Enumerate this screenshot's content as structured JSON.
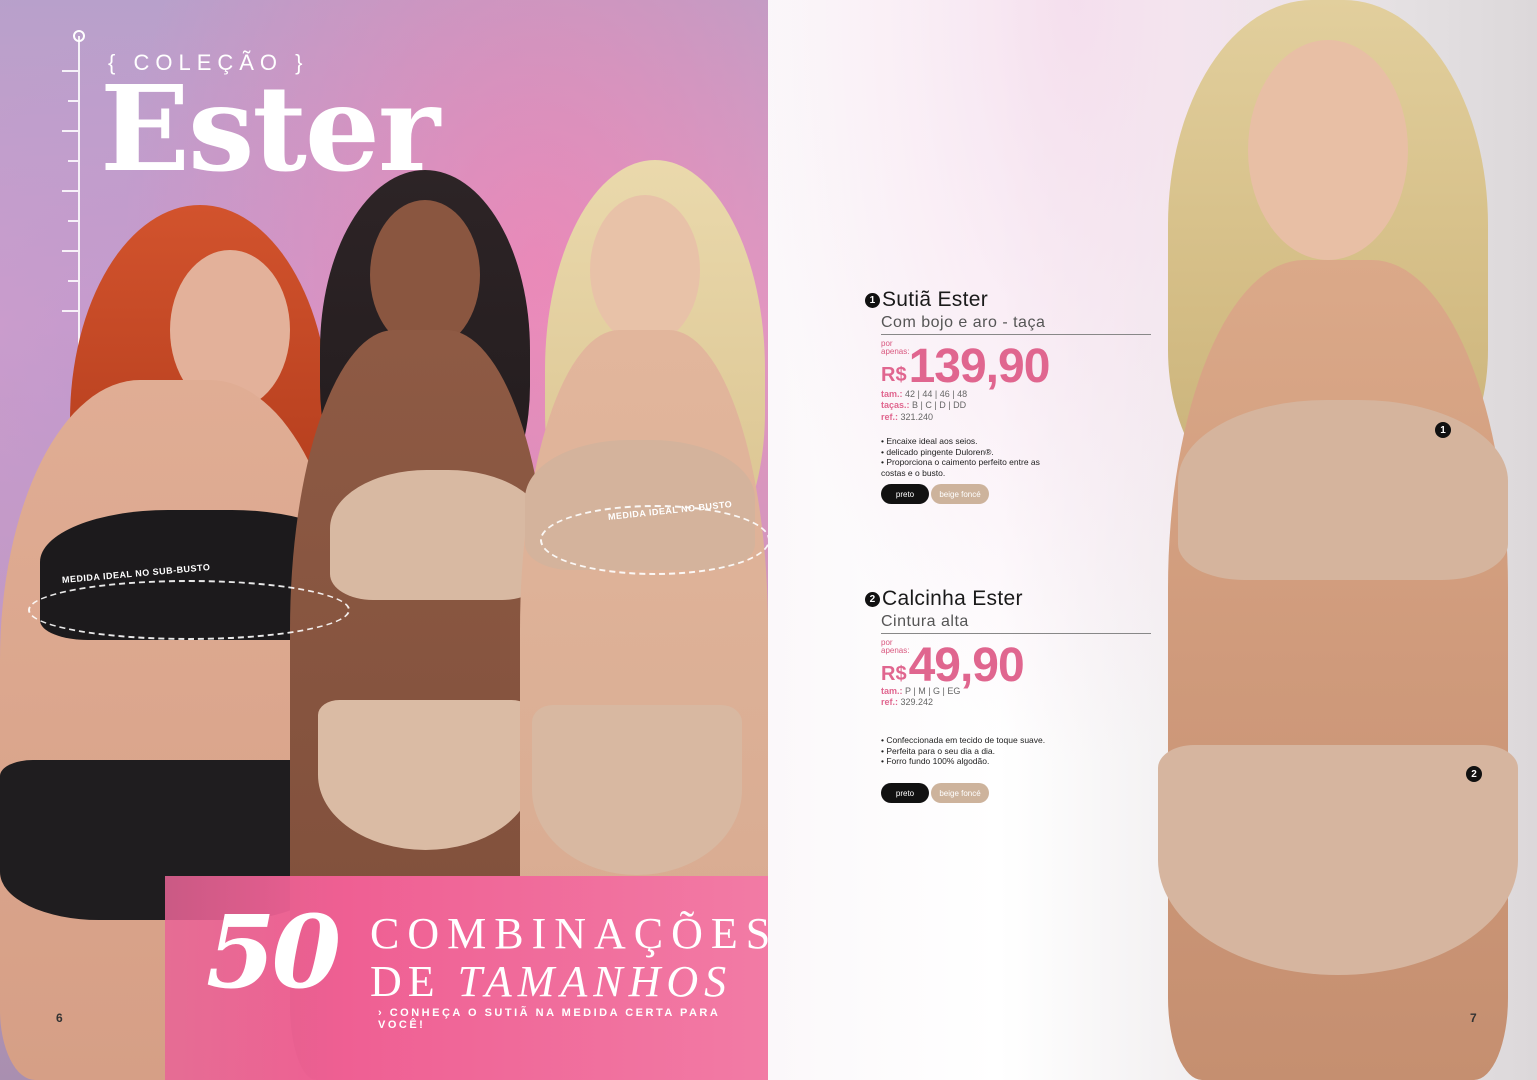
{
  "left": {
    "collection_label": "{ COLEÇÃO }",
    "title": "Ester",
    "measure_under_bust": "MEDIDA IDEAL NO SUB-BUSTO",
    "measure_bust": "MEDIDA IDEAL NO BUSTO",
    "banner_number": "50",
    "banner_line1": "COMBINAÇÕES",
    "banner_line2_prefix": "DE ",
    "banner_line2_italic": "TAMANHOS",
    "banner_cta": "› CONHEÇA O SUTIÃ NA MEDIDA CERTA PARA VOCÊ!",
    "page_number": "6"
  },
  "right": {
    "page_number": "7",
    "products": [
      {
        "marker": "1",
        "name": "Sutiã Ester",
        "subtitle": "Com bojo e aro - taça",
        "por_label": "por",
        "apenas_label": "apenas:",
        "currency": "R$",
        "price": "139,90",
        "sizes_label": "tam.:",
        "sizes": "42 | 44 | 46 | 48",
        "cups_label": "taças.:",
        "cups": "B | C | D | DD",
        "ref_label": "ref.:",
        "ref": "321.240",
        "features": [
          "• Encaixe ideal aos seios.",
          "• delicado pingente Duloren®.",
          "• Proporciona o caimento perfeito entre as costas e o busto."
        ],
        "colors": [
          "preto",
          "beige foncé"
        ]
      },
      {
        "marker": "2",
        "name": "Calcinha Ester",
        "subtitle": "Cintura alta",
        "por_label": "por",
        "apenas_label": "apenas:",
        "currency": "R$",
        "price": "49,90",
        "sizes_label": "tam.:",
        "sizes": "P | M | G | EG",
        "ref_label": "ref.:",
        "ref": "329.242",
        "features": [
          "• Confeccionada em tecido de toque suave.",
          "• Perfeita para o seu dia a dia.",
          "• Forro fundo 100% algodão."
        ],
        "colors": [
          "preto",
          "beige foncé"
        ]
      }
    ]
  },
  "colors": {
    "accent_pink": "#e0668f",
    "banner_pink": "#ef5f93",
    "bra_beige": "#d5b49d",
    "black": "#111111"
  }
}
